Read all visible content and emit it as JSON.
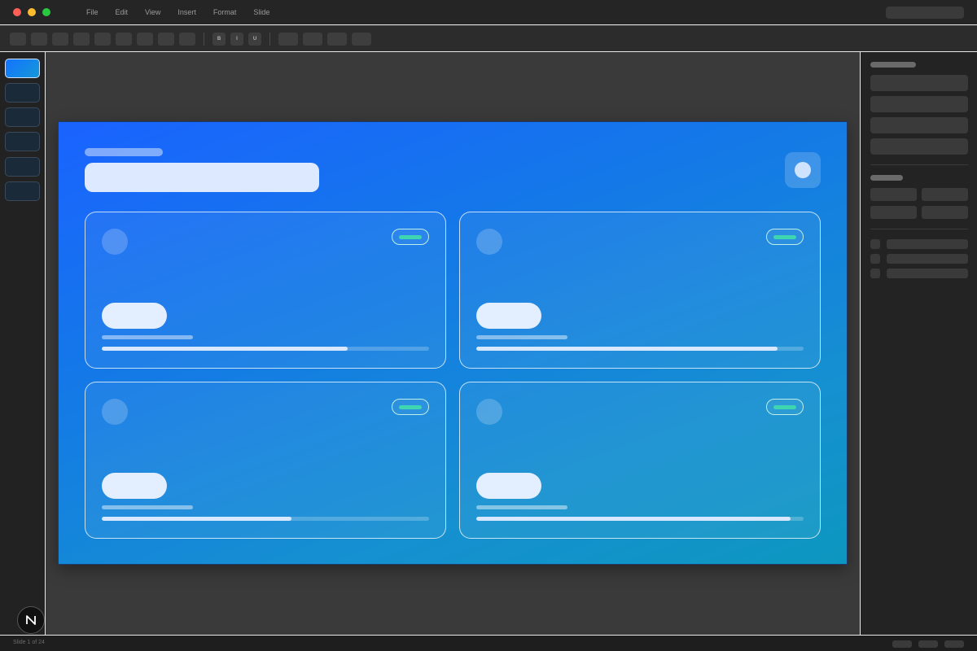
{
  "window": {
    "traffic_colors": [
      "#ff5f57",
      "#febc2e",
      "#28c840"
    ],
    "menu": [
      "File",
      "Edit",
      "View",
      "Insert",
      "Format",
      "Slide"
    ]
  },
  "toolbar": {
    "format_buttons": [
      "B",
      "I",
      "U"
    ]
  },
  "slides_rail": {
    "count": 6,
    "active_index": 0
  },
  "slide": {
    "cards": [
      {
        "progress": 0.75,
        "chip_color": "#3ed6b0"
      },
      {
        "progress": 0.92,
        "chip_color": "#3ed6b0"
      },
      {
        "progress": 0.58,
        "chip_color": "#3ed6b0"
      },
      {
        "progress": 0.96,
        "chip_color": "#3ed6b0"
      }
    ]
  },
  "statusbar": {
    "text": "Slide 1 of 24"
  },
  "colors": {
    "accent": "#1473ff",
    "slide_gradient_start": "#1a63ff",
    "slide_gradient_end": "#0d97c0"
  },
  "icons": {
    "app_logo": "n-logo-icon"
  }
}
